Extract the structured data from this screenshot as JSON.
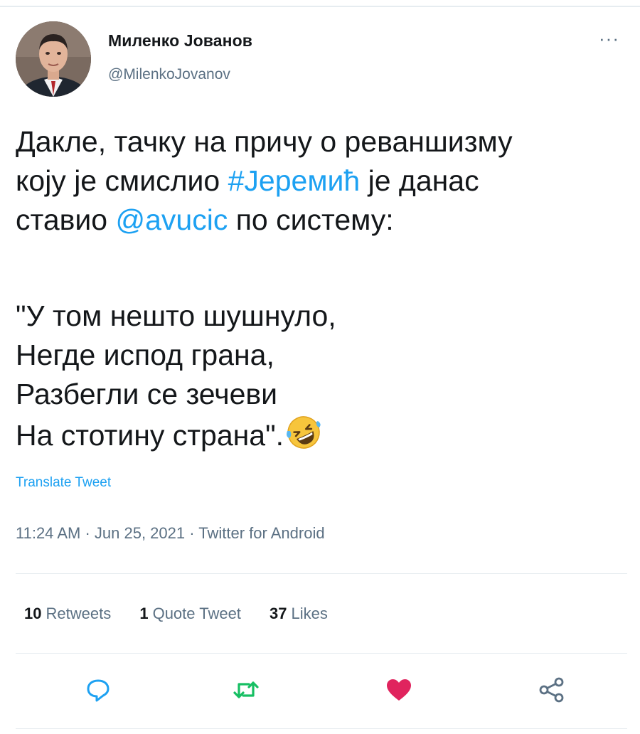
{
  "author": {
    "name": "Миленко Јованов",
    "handle": "@MilenkoJovanov",
    "more_icon": "more-horizontal-icon",
    "more_label": "···"
  },
  "tweet": {
    "lines": [
      {
        "parts": [
          {
            "text": "Дакле, тачку на причу о реваншизму",
            "type": "text"
          }
        ]
      },
      {
        "parts": [
          {
            "text": "коју је смислио ",
            "type": "text"
          },
          {
            "text": "#Јеремић",
            "type": "hashtag"
          },
          {
            "text": " је данас",
            "type": "text"
          }
        ]
      },
      {
        "parts": [
          {
            "text": "ставио ",
            "type": "text"
          },
          {
            "text": "@avucic",
            "type": "mention"
          },
          {
            "text": " по систему:",
            "type": "text"
          }
        ]
      },
      {
        "parts": []
      },
      {
        "parts": [
          {
            "text": "\"У том нешто шушнуло,",
            "type": "text"
          }
        ]
      },
      {
        "parts": [
          {
            "text": "Негде испод грана,",
            "type": "text"
          }
        ]
      },
      {
        "parts": [
          {
            "text": "Разбегли се зечеви",
            "type": "text"
          }
        ]
      },
      {
        "parts": [
          {
            "text": "На стотину страна\".",
            "type": "text"
          }
        ]
      }
    ],
    "emoji": "rolling-on-floor-laughing-emoji"
  },
  "translate_label": "Translate Tweet",
  "meta": {
    "time": "11:24 AM",
    "date": "Jun 25, 2021",
    "source": "Twitter for Android",
    "separator": " · "
  },
  "stats": {
    "retweets": {
      "count": "10",
      "label": "Retweets"
    },
    "quotes": {
      "count": "1",
      "label": "Quote Tweet"
    },
    "likes": {
      "count": "37",
      "label": "Likes"
    }
  },
  "actions": [
    {
      "name": "reply-icon",
      "color": "#1da1f2"
    },
    {
      "name": "retweet-icon",
      "color": "#17bf63"
    },
    {
      "name": "like-icon",
      "color": "#e0245e"
    },
    {
      "name": "share-icon",
      "color": "#5b7083"
    }
  ],
  "colors": {
    "link": "#1da1f2",
    "secondary_text": "#5b7083",
    "primary_text": "#14171a",
    "divider": "#e6ecf0"
  }
}
